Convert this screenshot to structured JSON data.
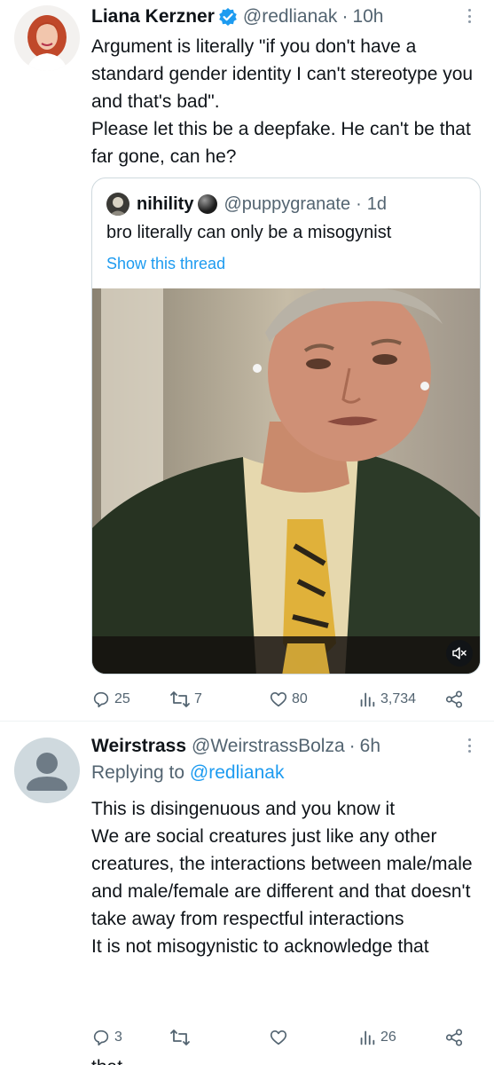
{
  "tweet1": {
    "author": {
      "name": "Liana Kerzner",
      "handle": "@redlianak",
      "time": "10h",
      "verified": true
    },
    "text": "Argument is literally \"if you don't have a standard gender identity I can't stereotype you and that's bad\".\nPlease let this be a deepfake. He can't be that far gone, can he?",
    "quote": {
      "name": "nihility",
      "handle": "@puppygranate",
      "time": "1d",
      "text": "bro literally can only be a misogynist",
      "show_thread": "Show this thread"
    },
    "actions": {
      "replies": "25",
      "retweets": "7",
      "likes": "80",
      "views": "3,734"
    }
  },
  "tweet2": {
    "author": {
      "name": "Weirstrass",
      "handle": "@WeirstrassBolza",
      "time": "6h"
    },
    "replying_prefix": "Replying to ",
    "replying_to": "@redlianak",
    "text": "This is disingenuous and you know it\nWe are social creatures just like any other creatures, the interactions between male/male and male/female are different  and that doesn't take away from respectful interactions\nIt is not misogynistic to acknowledge that",
    "actions": {
      "replies": "3",
      "retweets": "",
      "likes": "",
      "views": "26"
    },
    "cutoff_text": "that"
  },
  "dot_separator": "·",
  "colors": {
    "link": "#1d9bf0",
    "secondary": "#536471",
    "verified": "#1d9bf0",
    "border": "#cfd9de"
  },
  "icons": [
    "more-icon",
    "verified-icon",
    "reply-icon",
    "retweet-icon",
    "like-icon",
    "views-icon",
    "share-icon",
    "mute-icon"
  ]
}
